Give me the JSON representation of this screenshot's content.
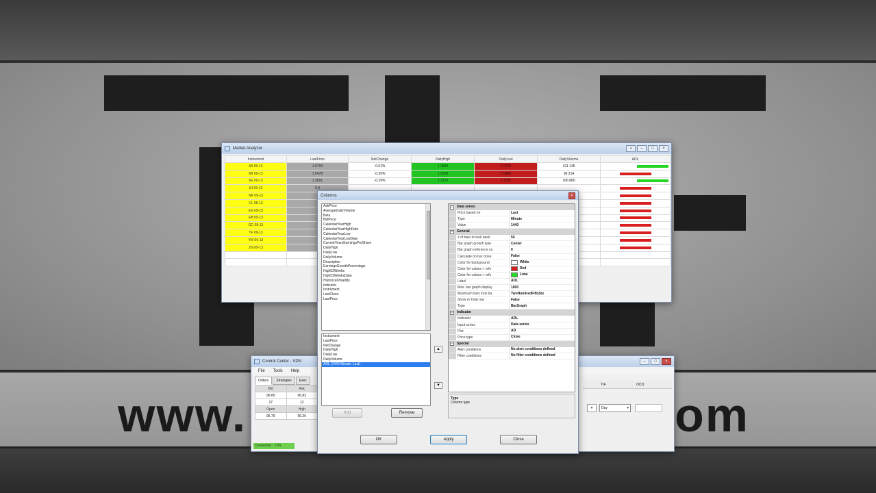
{
  "wallpaper": {
    "url_left": "www.",
    "url_right": "om"
  },
  "market_analyzer": {
    "title": "Market Analyzer",
    "columns": [
      "Instrument",
      "LastPrice",
      "NetChange",
      "DailyHigh",
      "DailyLow",
      "DailyVolume",
      "ADL"
    ],
    "rows": [
      {
        "instrument": "6A 09-13",
        "last": "1.0794",
        "change": "-0.61%",
        "high": "1.0840",
        "low": "1.0720",
        "volume": "121 135",
        "adl": "green"
      },
      {
        "instrument": "6B 09-13",
        "last": "1.5478",
        "change": "-0.35%",
        "high": "1.5508",
        "low": "1.5440",
        "volume": "96 214",
        "adl": "red"
      },
      {
        "instrument": "6E 09-13",
        "last": "1.3091",
        "change": "-0.29%",
        "high": "1.3126",
        "low": "1.3060",
        "volume": "166 880",
        "adl": "green"
      },
      {
        "instrument": "6J 09-13",
        "last": "0.9",
        "change": "",
        "high": "",
        "low": "",
        "volume": "",
        "adl": "red"
      },
      {
        "instrument": "NK 09-13",
        "last": "",
        "change": "",
        "high": "",
        "low": "",
        "volume": "",
        "adl": "red"
      },
      {
        "instrument": "CL 08-13",
        "last": "",
        "change": "",
        "high": "",
        "low": "",
        "volume": "",
        "adl": "red"
      },
      {
        "instrument": "ES 09-13",
        "last": "",
        "change": "",
        "high": "",
        "low": "",
        "volume": "",
        "adl": "red"
      },
      {
        "instrument": "EB 09-13",
        "last": "",
        "change": "",
        "high": "",
        "low": "",
        "volume": "",
        "adl": "red"
      },
      {
        "instrument": "GC 08-13",
        "last": "",
        "change": "",
        "high": "",
        "low": "",
        "volume": "",
        "adl": "red"
      },
      {
        "instrument": "TF 09-13",
        "last": "",
        "change": "",
        "high": "",
        "low": "",
        "volume": "",
        "adl": "red"
      },
      {
        "instrument": "YM 09-13",
        "last": "",
        "change": "",
        "high": "",
        "low": "",
        "volume": "",
        "adl": "red"
      },
      {
        "instrument": "ZN 09-13",
        "last": "",
        "change": "",
        "high": "",
        "low": "",
        "volume": "",
        "adl": "red"
      }
    ]
  },
  "control_center": {
    "title": "Control Center - VDN",
    "menu": [
      "File",
      "Tools",
      "Help"
    ],
    "tabs": [
      "Orders",
      "Strategies",
      "Exec"
    ],
    "grid": {
      "bid_label": "Bid",
      "ask_label": "Ask",
      "bid": "96.80",
      "ask": "96.83",
      "bid_size": "27",
      "ask_size": "12",
      "open_label": "Open",
      "high_label": "High",
      "open": "95.79",
      "high": "96.26"
    },
    "tif_label": "TIF",
    "tif_value": "Day",
    "oco_label": "OCO",
    "status": "Connected - TDS"
  },
  "columns_dialog": {
    "title": "Columns",
    "available": [
      "AskPrice",
      "AverageDailyVolume",
      "Beta",
      "BidPrice",
      "CalendarYearHigh",
      "CalendarYearHighDate",
      "CalendarYearLow",
      "CalendarYearLowDate",
      "CurrentYearsEarningsPerShare",
      "DailyHigh",
      "DailyLow",
      "DailyVolume",
      "Description",
      "EarningsGrowthPercentage",
      "High52Weeks",
      "High52WeeksDate",
      "HistoricalVolatility",
      "Indicator",
      "Instrument",
      "LastClose",
      "LastPrice"
    ],
    "selected": [
      "Instrument",
      "LastPrice",
      "NetChange",
      "DailyHigh",
      "DailyLow",
      "DailyVolume",
      "ADL (1440 Minute, Last)"
    ],
    "selected_index": 6,
    "add_label": "Add",
    "remove_label": "Remove",
    "ok_label": "OK",
    "apply_label": "Apply",
    "close_label": "Close",
    "properties": [
      {
        "category": "Data series",
        "rows": [
          {
            "name": "Price based on",
            "value": "Last"
          },
          {
            "name": "Type",
            "value": "Minute"
          },
          {
            "name": "Value",
            "value": "1440"
          }
        ]
      },
      {
        "category": "General",
        "rows": [
          {
            "name": "# of bars to look back",
            "value": "50"
          },
          {
            "name": "Bar graph growth type",
            "value": "Center"
          },
          {
            "name": "Bar graph reference va",
            "value": "0"
          },
          {
            "name": "Calculate on bar close",
            "value": "False"
          },
          {
            "name": "Color for background",
            "value": "White",
            "swatch": "#ffffff"
          },
          {
            "name": "Color for values < refe",
            "value": "Red",
            "swatch": "#d81e1e"
          },
          {
            "name": "Color for values > refe",
            "value": "Lime",
            "swatch": "#22dd22"
          },
          {
            "name": "Label",
            "value": "ADL"
          },
          {
            "name": "Max. bar graph display",
            "value": "1000"
          },
          {
            "name": "Maximum bars look ba",
            "value": "TwoHundredFiftySix"
          },
          {
            "name": "Show in Total row",
            "value": "False"
          },
          {
            "name": "Type",
            "value": "BarGraph"
          }
        ]
      },
      {
        "category": "Indicator",
        "rows": [
          {
            "name": "Indicator",
            "value": "ADL"
          },
          {
            "name": "Input series",
            "value": "Data series"
          },
          {
            "name": "Plot",
            "value": "AD"
          },
          {
            "name": "Price type",
            "value": "Close"
          }
        ]
      },
      {
        "category": "Special",
        "rows": [
          {
            "name": "Alert conditions",
            "value": "No alert conditions defined"
          },
          {
            "name": "Filter conditions",
            "value": "No filter conditions defined"
          }
        ]
      }
    ],
    "help_title": "Type",
    "help_text": "Column type"
  }
}
